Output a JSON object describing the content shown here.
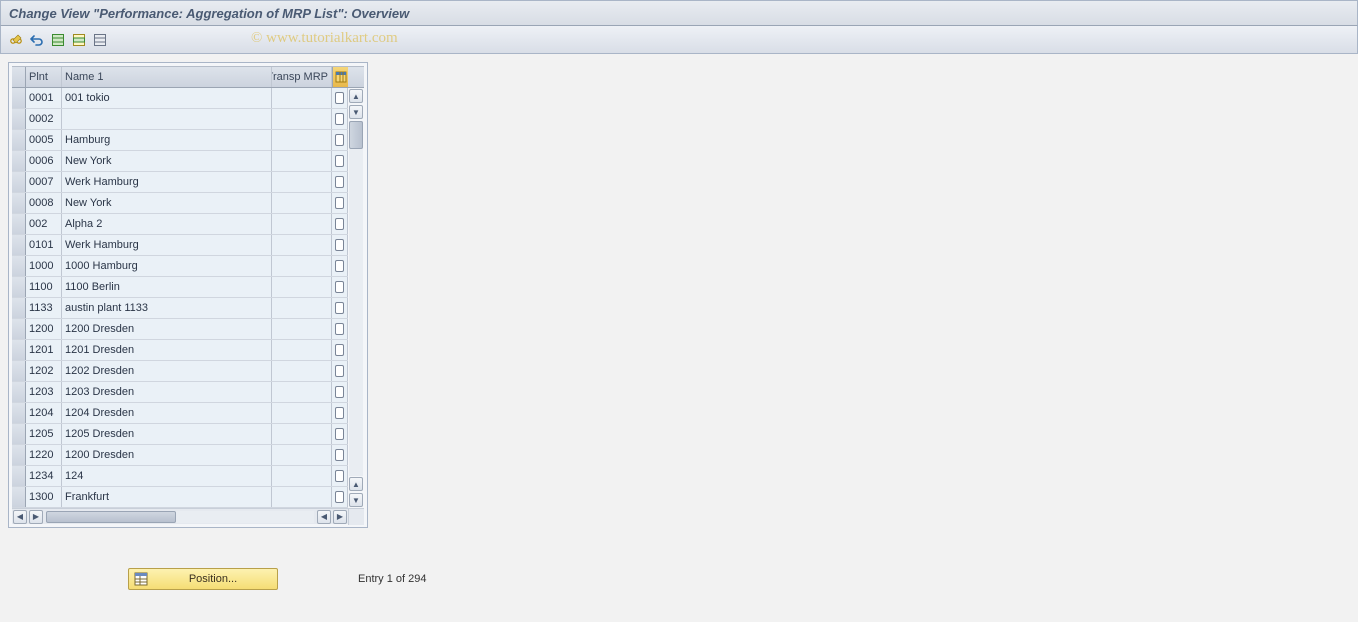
{
  "title": "Change View \"Performance: Aggregation of MRP List\": Overview",
  "watermark": "© www.tutorialkart.com",
  "toolbar": {
    "icons": [
      "toggle-display-change",
      "undo",
      "select-all",
      "select-block",
      "deselect-all"
    ]
  },
  "columns": {
    "plnt": "Plnt",
    "name1": "Name 1",
    "transp": "Transp MRP"
  },
  "rows": [
    {
      "plnt": "0001",
      "name": "001 tokio",
      "transp": false
    },
    {
      "plnt": "0002",
      "name": "",
      "transp": false
    },
    {
      "plnt": "0005",
      "name": "Hamburg",
      "transp": false
    },
    {
      "plnt": "0006",
      "name": "New York",
      "transp": false
    },
    {
      "plnt": "0007",
      "name": "Werk Hamburg",
      "transp": false
    },
    {
      "plnt": "0008",
      "name": "New York",
      "transp": false
    },
    {
      "plnt": "002",
      "name": "Alpha 2",
      "transp": false
    },
    {
      "plnt": "0101",
      "name": "Werk Hamburg",
      "transp": false
    },
    {
      "plnt": "1000",
      "name": "1000 Hamburg",
      "transp": false
    },
    {
      "plnt": "1100",
      "name": "1100 Berlin",
      "transp": false
    },
    {
      "plnt": "1133",
      "name": "austin plant 1133",
      "transp": false
    },
    {
      "plnt": "1200",
      "name": "1200 Dresden",
      "transp": false
    },
    {
      "plnt": "1201",
      "name": "1201 Dresden",
      "transp": false
    },
    {
      "plnt": "1202",
      "name": "1202 Dresden",
      "transp": false
    },
    {
      "plnt": "1203",
      "name": "1203 Dresden",
      "transp": false
    },
    {
      "plnt": "1204",
      "name": "1204 Dresden",
      "transp": false
    },
    {
      "plnt": "1205",
      "name": "1205 Dresden",
      "transp": false
    },
    {
      "plnt": "1220",
      "name": "1200 Dresden",
      "transp": false
    },
    {
      "plnt": "1234",
      "name": "124",
      "transp": false
    },
    {
      "plnt": "1300",
      "name": "Frankfurt",
      "transp": false
    }
  ],
  "position_button": "Position...",
  "entry_status": "Entry 1 of 294"
}
